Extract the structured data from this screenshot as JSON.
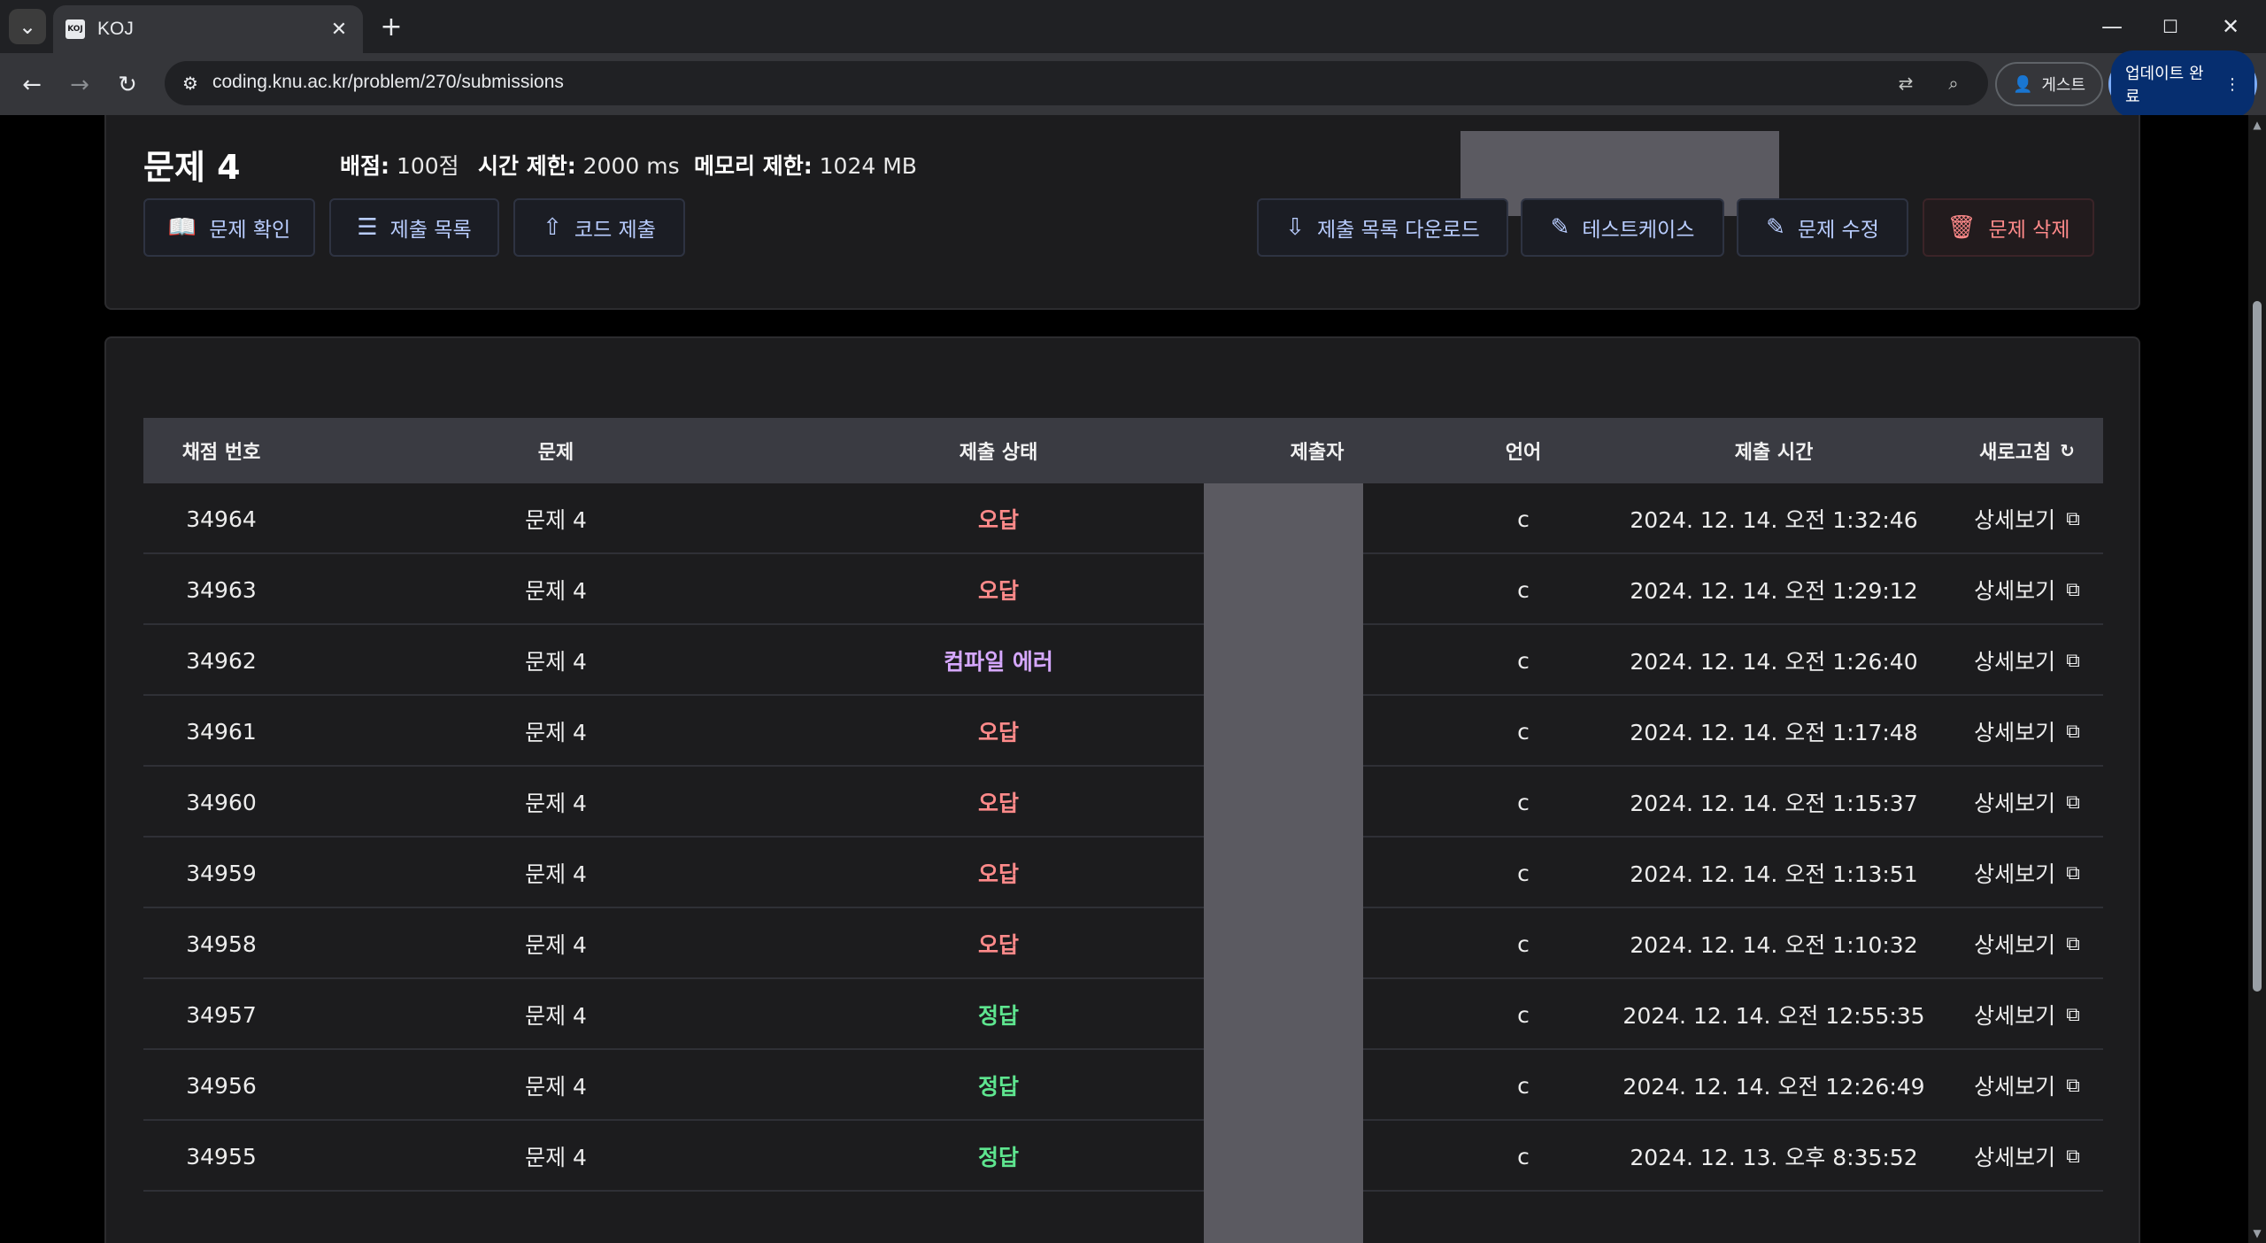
{
  "browser": {
    "tab_title": "KOJ",
    "favicon_text": "KOJ",
    "url": "coding.knu.ac.kr/problem/270/submissions",
    "guest_label": "게스트",
    "update_label": "업데이트 완료"
  },
  "problem": {
    "title": "문제 4",
    "score_label": "배점:",
    "score_value": "100점",
    "time_label": "시간 제한:",
    "time_value": "2000 ms",
    "memory_label": "메모리 제한:",
    "memory_value": "1024 MB"
  },
  "buttons": {
    "check": "문제 확인",
    "submissions": "제출 목록",
    "submit": "코드 제출",
    "download": "제출 목록 다운로드",
    "testcase": "테스트케이스",
    "edit": "문제 수정",
    "delete": "문제 삭제"
  },
  "table": {
    "headers": {
      "id": "채점 번호",
      "problem": "문제",
      "status": "제출 상태",
      "submitter": "제출자",
      "language": "언어",
      "time": "제출 시간",
      "refresh": "새로고침"
    },
    "rows": [
      {
        "id": "34964",
        "problem": "문제 4",
        "status": "오답",
        "lang": "c",
        "time": "2024. 12. 14. 오전 1:32:46",
        "detail": "상세보기"
      },
      {
        "id": "34963",
        "problem": "문제 4",
        "status": "오답",
        "lang": "c",
        "time": "2024. 12. 14. 오전 1:29:12",
        "detail": "상세보기"
      },
      {
        "id": "34962",
        "problem": "문제 4",
        "status": "컴파일 에러",
        "lang": "c",
        "time": "2024. 12. 14. 오전 1:26:40",
        "detail": "상세보기"
      },
      {
        "id": "34961",
        "problem": "문제 4",
        "status": "오답",
        "lang": "c",
        "time": "2024. 12. 14. 오전 1:17:48",
        "detail": "상세보기"
      },
      {
        "id": "34960",
        "problem": "문제 4",
        "status": "오답",
        "lang": "c",
        "time": "2024. 12. 14. 오전 1:15:37",
        "detail": "상세보기"
      },
      {
        "id": "34959",
        "problem": "문제 4",
        "status": "오답",
        "lang": "c",
        "time": "2024. 12. 14. 오전 1:13:51",
        "detail": "상세보기"
      },
      {
        "id": "34958",
        "problem": "문제 4",
        "status": "오답",
        "lang": "c",
        "time": "2024. 12. 14. 오전 1:10:32",
        "detail": "상세보기"
      },
      {
        "id": "34957",
        "problem": "문제 4",
        "status": "정답",
        "lang": "c",
        "time": "2024. 12. 14. 오전 12:55:35",
        "detail": "상세보기"
      },
      {
        "id": "34956",
        "problem": "문제 4",
        "status": "정답",
        "lang": "c",
        "time": "2024. 12. 14. 오전 12:26:49",
        "detail": "상세보기"
      },
      {
        "id": "34955",
        "problem": "문제 4",
        "status": "정답",
        "lang": "c",
        "time": "2024. 12. 13. 오후 8:35:52",
        "detail": "상세보기"
      }
    ]
  },
  "colors": {
    "wrong": "#ff8a8a",
    "compile_error": "#d6a8ff",
    "correct": "#5ee58f"
  }
}
